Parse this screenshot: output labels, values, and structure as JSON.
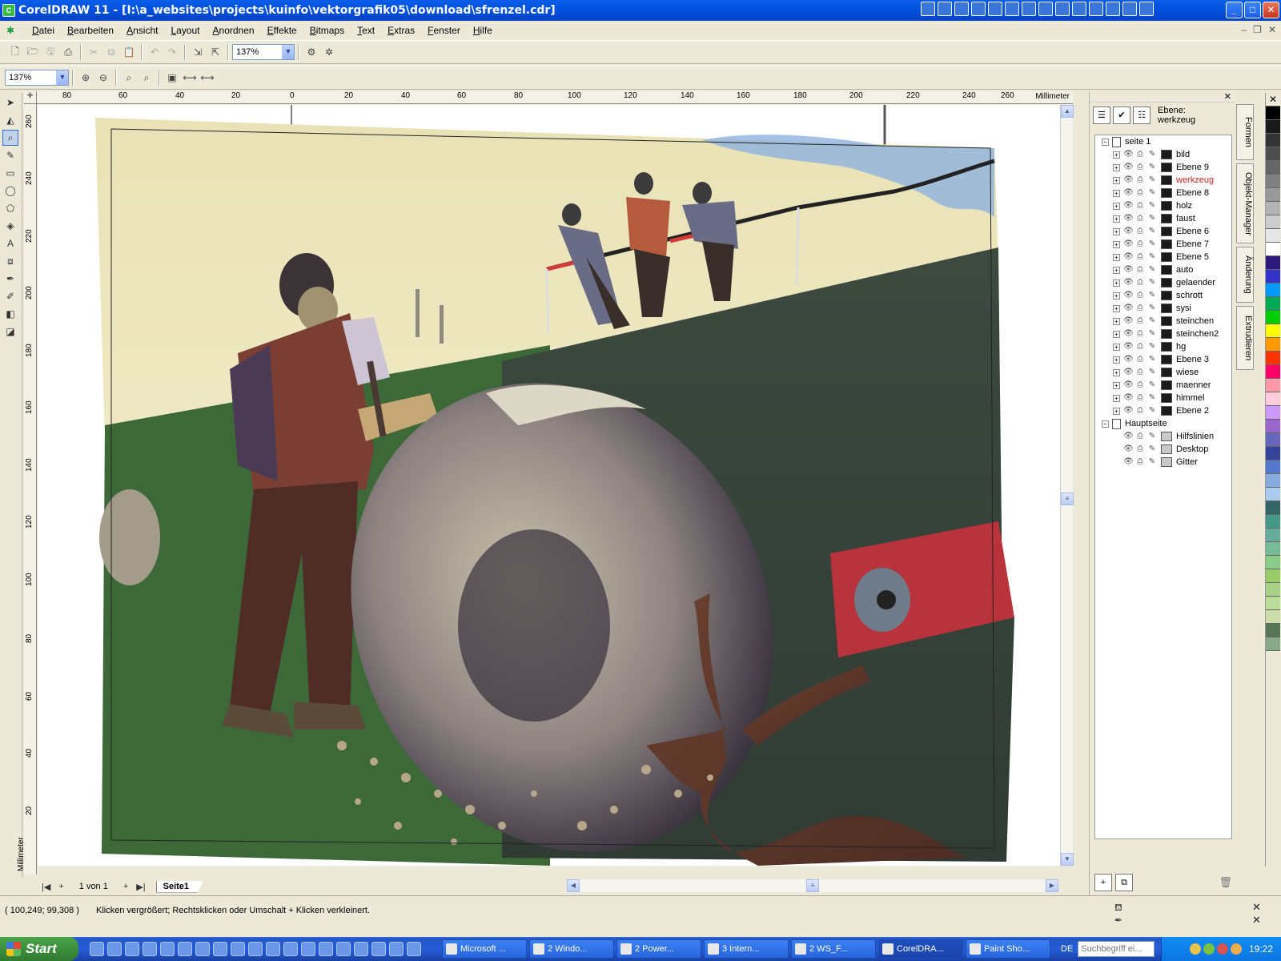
{
  "window": {
    "title": "CorelDRAW 11 - [I:\\a_websites\\projects\\kuinfo\\vektorgrafik05\\download\\sfrenzel.cdr]",
    "min": "_",
    "max": "□",
    "close": "✕"
  },
  "menu": [
    "Datei",
    "Bearbeiten",
    "Ansicht",
    "Layout",
    "Anordnen",
    "Effekte",
    "Bitmaps",
    "Text",
    "Extras",
    "Fenster",
    "Hilfe"
  ],
  "toolbar": {
    "zoom_value": "137%"
  },
  "zoombar": {
    "zoom_value": "137%"
  },
  "rulers": {
    "unit": "Millimeter",
    "top_labels": [
      "80",
      "60",
      "40",
      "20",
      "0",
      "20",
      "40",
      "60",
      "80",
      "100",
      "120",
      "140",
      "160",
      "180",
      "200",
      "220",
      "240",
      "260"
    ],
    "left_labels": [
      "260",
      "240",
      "220",
      "200",
      "180",
      "160",
      "140",
      "120",
      "100",
      "80",
      "60",
      "40",
      "20"
    ]
  },
  "pagenav": {
    "page_count": "1 von 1",
    "tab": "Seite1"
  },
  "docker": {
    "layer_label_1": "Ebene:",
    "layer_label_2": "werkzeug",
    "page": "seite 1",
    "layers": [
      "bild",
      "Ebene 9",
      "werkzeug",
      "Ebene 8",
      "holz",
      "faust",
      "Ebene 6",
      "Ebene 7",
      "Ebene 5",
      "auto",
      "gelaender",
      "schrott",
      "sysi",
      "steinchen",
      "steinchen2",
      "hg",
      "Ebene 3",
      "wiese",
      "maenner",
      "himmel",
      "Ebene 2"
    ],
    "active_layer": "werkzeug",
    "master": "Hauptseite",
    "master_layers": [
      "Hilfslinien",
      "Desktop",
      "Gitter"
    ]
  },
  "vtabs": [
    "Formen",
    "Objekt-Manager",
    "Änderung",
    "Extrudieren"
  ],
  "status": {
    "coords": "( 100,249; 99,308 )",
    "message": "Klicken vergrößert; Rechtsklicken oder Umschalt + Klicken verkleinert."
  },
  "taskbar": {
    "start": "Start",
    "tasks": [
      "Microsoft ...",
      "2 Windo...",
      "2 Power...",
      "3 Intern...",
      "2 WS_F...",
      "CorelDRA...",
      "Paint Sho..."
    ],
    "lang": "DE",
    "search_placeholder": "Suchbegriff ei...",
    "clock": "19:22"
  },
  "palette": [
    "#000000",
    "#1a1a1a",
    "#333333",
    "#4d4d4d",
    "#666666",
    "#808080",
    "#999999",
    "#b3b3b3",
    "#cccccc",
    "#e6e6e6",
    "#ffffff",
    "#2b1a7a",
    "#3333cc",
    "#0099ff",
    "#00aa55",
    "#00cc00",
    "#ffff00",
    "#ff9900",
    "#ff3300",
    "#ff0066",
    "#ff99aa",
    "#ffccdd",
    "#cc99ff",
    "#9966cc",
    "#6666bb",
    "#334499",
    "#5577cc",
    "#88aadd",
    "#aaccee",
    "#336666",
    "#449988",
    "#66aa99",
    "#77bb99",
    "#88cc88",
    "#99cc66",
    "#aad088",
    "#bbdd99",
    "#ccddaa",
    "#557755",
    "#88aa88"
  ]
}
